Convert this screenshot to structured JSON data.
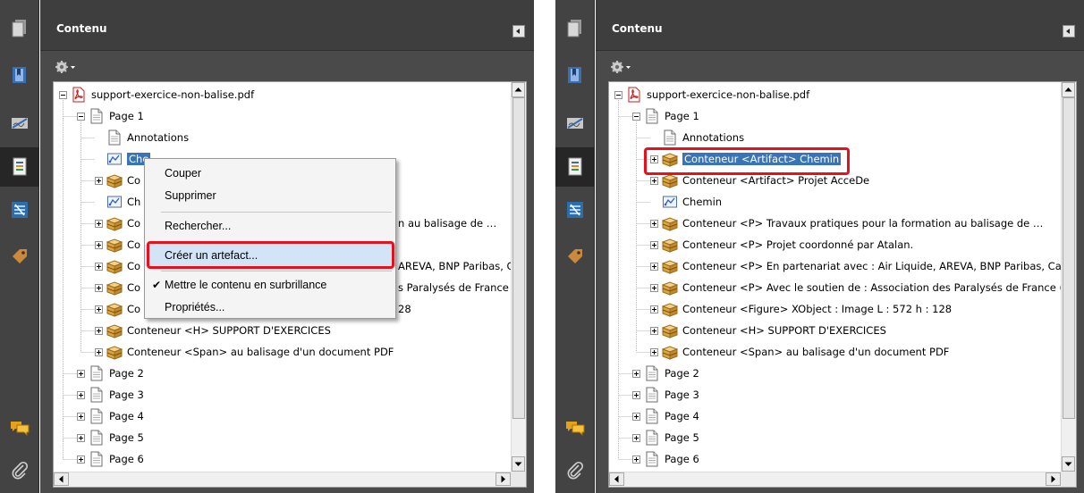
{
  "left": {
    "panel_title": "Contenu",
    "tree": [
      {
        "text": "support-exercice-non-balise.pdf",
        "icon": "pdf-icon",
        "exp": "minus"
      },
      {
        "text": "Page 1",
        "icon": "page-icon",
        "exp": "minus"
      },
      {
        "text": "Annotations",
        "icon": "page-icon",
        "exp": "none"
      },
      {
        "text": "Che",
        "icon": "path-icon",
        "exp": "none",
        "selected": true
      },
      {
        "text": "Co",
        "icon": "container-icon",
        "exp": "plus"
      },
      {
        "text": "Ch",
        "icon": "path-icon",
        "exp": "none"
      },
      {
        "text": "Co",
        "icon": "container-icon",
        "exp": "plus",
        "tail": "n au balisage de …"
      },
      {
        "text": "Co",
        "icon": "container-icon",
        "exp": "plus"
      },
      {
        "text": "Co",
        "icon": "container-icon",
        "exp": "plus",
        "tail": "AREVA, BNP Paribas, Ca"
      },
      {
        "text": "Co",
        "icon": "container-icon",
        "exp": "plus",
        "tail": "s Paralysés de France ("
      },
      {
        "text": "Co",
        "icon": "container-icon",
        "exp": "plus",
        "tail": "28"
      },
      {
        "text": "Conteneur <H> SUPPORT D'EXERCICES",
        "icon": "container-icon",
        "exp": "plus"
      },
      {
        "text": "Conteneur <Span> au balisage d'un document PDF",
        "icon": "container-icon",
        "exp": "plus"
      },
      {
        "text": "Page 2",
        "icon": "page-icon",
        "exp": "plus"
      },
      {
        "text": "Page 3",
        "icon": "page-icon",
        "exp": "plus"
      },
      {
        "text": "Page 4",
        "icon": "page-icon",
        "exp": "plus"
      },
      {
        "text": "Page 5",
        "icon": "page-icon",
        "exp": "plus"
      },
      {
        "text": "Page 6",
        "icon": "page-icon",
        "exp": "plus"
      }
    ],
    "context_menu": {
      "items": [
        "Couper",
        "Supprimer",
        "Rechercher...",
        "Créer un artefact...",
        "Mettre le contenu en surbrillance",
        "Propriétés..."
      ],
      "checked_item": "Mettre le contenu en surbrillance",
      "highlighted_item": "Créer un artefact..."
    }
  },
  "right": {
    "panel_title": "Contenu",
    "tree": [
      {
        "text": "support-exercice-non-balise.pdf",
        "icon": "pdf-icon",
        "exp": "minus"
      },
      {
        "text": "Page 1",
        "icon": "page-icon",
        "exp": "minus"
      },
      {
        "text": "Annotations",
        "icon": "page-icon",
        "exp": "none"
      },
      {
        "text": "Conteneur <Artifact> Chemin",
        "icon": "container-icon",
        "exp": "plus",
        "selected": true
      },
      {
        "text": "Conteneur <Artifact> Projet AcceDe",
        "icon": "container-icon",
        "exp": "plus"
      },
      {
        "text": "Chemin",
        "icon": "path-icon",
        "exp": "none"
      },
      {
        "text": "Conteneur <P> Travaux pratiques pour la formation au balisage de …",
        "icon": "container-icon",
        "exp": "plus"
      },
      {
        "text": "Conteneur <P> Projet coordonné par Atalan.",
        "icon": "container-icon",
        "exp": "plus"
      },
      {
        "text": "Conteneur <P> En partenariat avec : Air Liquide, AREVA, BNP Paribas, Ca",
        "icon": "container-icon",
        "exp": "plus"
      },
      {
        "text": "Conteneur <P> Avec le soutien de : Association des Paralysés de France (",
        "icon": "container-icon",
        "exp": "plus"
      },
      {
        "text": "Conteneur <Figure> XObject : Image  L : 572 h : 128",
        "icon": "container-icon",
        "exp": "plus"
      },
      {
        "text": "Conteneur <H> SUPPORT D'EXERCICES",
        "icon": "container-icon",
        "exp": "plus"
      },
      {
        "text": "Conteneur <Span> au balisage d'un document PDF",
        "icon": "container-icon",
        "exp": "plus"
      },
      {
        "text": "Page 2",
        "icon": "page-icon",
        "exp": "plus"
      },
      {
        "text": "Page 3",
        "icon": "page-icon",
        "exp": "plus"
      },
      {
        "text": "Page 4",
        "icon": "page-icon",
        "exp": "plus"
      },
      {
        "text": "Page 5",
        "icon": "page-icon",
        "exp": "plus"
      },
      {
        "text": "Page 6",
        "icon": "page-icon",
        "exp": "plus"
      }
    ]
  },
  "colors": {
    "highlight_red": "#e8111b",
    "panel_dark": "#4a4a4a",
    "selection_blue": "#3a74b8",
    "menu_hover": "#d4e4f7"
  }
}
